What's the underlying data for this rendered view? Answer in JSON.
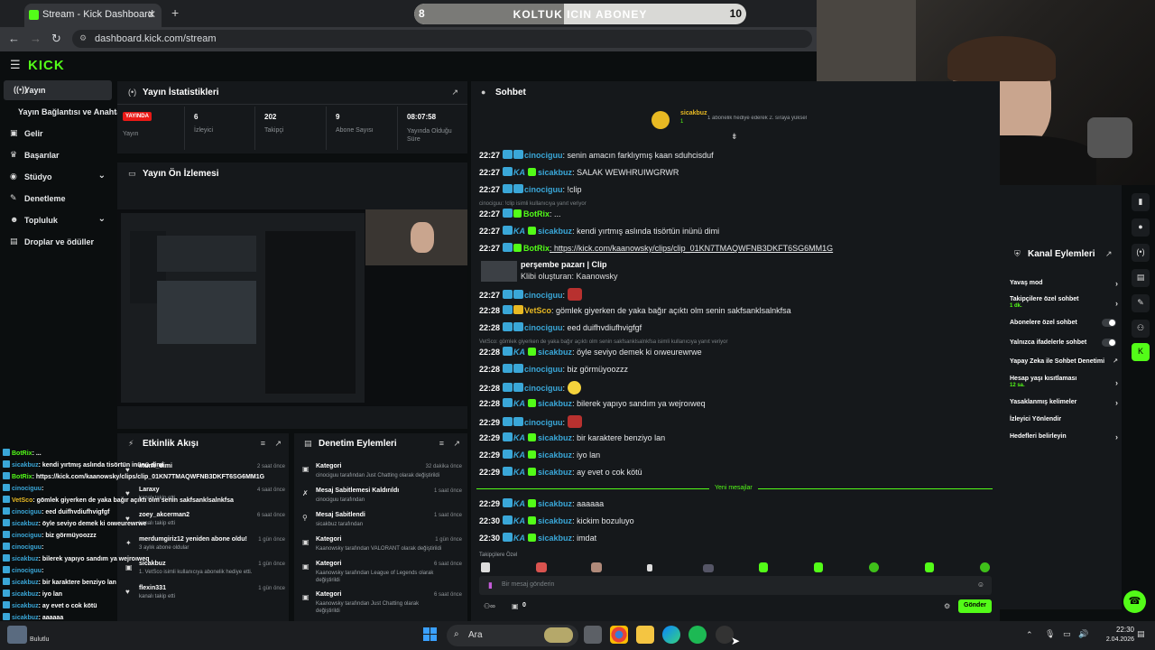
{
  "browser": {
    "tab_title": "Stream - Kick Dashboard",
    "url": "dashboard.kick.com/stream"
  },
  "overlay_goal": {
    "left": "8",
    "label": "KOLTUK ICIN ABONEY",
    "right": "10",
    "progress": 0.45
  },
  "kick": {
    "logo": "KICK"
  },
  "sidebar": {
    "items": [
      {
        "label": "Yayın"
      },
      {
        "label": "Yayın Bağlantısı ve Anahtarı"
      },
      {
        "label": "Gelir"
      },
      {
        "label": "Başarılar"
      },
      {
        "label": "Stüdyo"
      },
      {
        "label": "Denetleme"
      },
      {
        "label": "Topluluk"
      },
      {
        "label": "Droplar ve ödüller"
      }
    ]
  },
  "stats": {
    "title": "Yayın İstatistikleri",
    "live_badge": "YAYINDA",
    "items": [
      {
        "value": "",
        "label": "Yayın"
      },
      {
        "value": "6",
        "label": "İzleyici"
      },
      {
        "value": "202",
        "label": "Takipçi"
      },
      {
        "value": "9",
        "label": "Abone Sayısı"
      },
      {
        "value": "08:07:58",
        "label": "Yayında Olduğu Süre"
      }
    ]
  },
  "preview": {
    "title": "Yayın Ön İzlemesi"
  },
  "activity": {
    "title": "Etkinlik Akışı",
    "rows": [
      {
        "name": "inumi_dimi",
        "sub": "",
        "time": "2 saat önce"
      },
      {
        "name": "Laraxy",
        "sub": "kanalı takip etti",
        "time": "4 saat önce"
      },
      {
        "name": "zoey_akcerman2",
        "sub": "kanalı takip etti",
        "time": "6 saat önce"
      },
      {
        "name": "merdumgiriz12 yeniden abone oldu!",
        "sub": "3 aylık abone oldular",
        "time": "1 gün önce"
      },
      {
        "name": "sicakbuz",
        "sub": "1. VetSco isimli kullanıcıya abonelik hediye etti.",
        "time": "1 gün önce"
      },
      {
        "name": "flexin331",
        "sub": "kanalı takip etti",
        "time": "1 gün önce"
      }
    ]
  },
  "moderation": {
    "title": "Denetim Eylemleri",
    "rows": [
      {
        "name": "Kategori",
        "sub": "cinociguu tarafından Just Chatting olarak değiştirildi",
        "time": "32 dakika önce"
      },
      {
        "name": "Mesaj Sabitlemesi Kaldırıldı",
        "sub": "cinociguu tarafından",
        "time": "1 saat önce"
      },
      {
        "name": "Mesaj Sabitlendi",
        "sub": "sicakbuz tarafından",
        "time": "1 saat önce"
      },
      {
        "name": "Kategori",
        "sub": "Kaanowsky tarafından VALORANT olarak değiştirildi",
        "time": "1 gün önce"
      },
      {
        "name": "Kategori",
        "sub": "Kaanowsky tarafından League of Legends olarak değiştirildi",
        "time": "6 saat önce"
      },
      {
        "name": "Kategori",
        "sub": "Kaanowsky tarafından Just Chatting olarak değiştirildi",
        "time": "6 saat önce"
      }
    ]
  },
  "chat": {
    "title": "Sohbet",
    "gifter": "sicakbuz",
    "gifter_count": "1",
    "gifter_note": "1 abonelik hediye ederek 2. sıraya yüksel",
    "messages": [
      {
        "time": "22:27",
        "user": "cinociguu",
        "color": "#3aa7d8",
        "ka": false,
        "text": ": senin amacın farklıymış kaan sduhcisduf"
      },
      {
        "time": "22:27",
        "user": "sicakbuz",
        "color": "#3aa7d8",
        "ka": true,
        "text": ": SALAK WEWHRUIWGRWR"
      },
      {
        "time": "22:27",
        "user": "cinociguu",
        "color": "#3aa7d8",
        "ka": false,
        "text": ": !clip"
      },
      {
        "time": "22:27",
        "user": "BotRix",
        "color": "#53fc18",
        "ka": false,
        "text": ": ..."
      },
      {
        "time": "22:27",
        "user": "sicakbuz",
        "color": "#3aa7d8",
        "ka": true,
        "text": ": kendi yırtmış aslında tisörtün inünü dimi"
      },
      {
        "time": "22:27",
        "user": "BotRix",
        "color": "#53fc18",
        "ka": false,
        "text": ": https://kick.com/kaanowsky/clips/clip_01KN7TMAQWFNB3DKFT6SG6MM1G"
      },
      {
        "time": "22:27",
        "user": "cinociguu",
        "color": "#3aa7d8",
        "ka": false,
        "text": ":"
      },
      {
        "time": "22:28",
        "user": "VetSco",
        "color": "#e8b923",
        "ka": false,
        "text": ": gömlek giyerken de yaka bağır açıktı olm senin sakfsanklsalnkfsa"
      },
      {
        "time": "22:28",
        "user": "cinociguu",
        "color": "#3aa7d8",
        "ka": false,
        "text": ": eed duifhvdiufhvigfgf"
      },
      {
        "time": "22:28",
        "user": "sicakbuz",
        "color": "#3aa7d8",
        "ka": true,
        "text": ": öyle seviyo demek ki oıweurewrwe"
      },
      {
        "time": "22:28",
        "user": "cinociguu",
        "color": "#3aa7d8",
        "ka": false,
        "text": ": biz görmüyoozzz"
      },
      {
        "time": "22:28",
        "user": "cinociguu",
        "color": "#3aa7d8",
        "ka": false,
        "text": ":"
      },
      {
        "time": "22:28",
        "user": "sicakbuz",
        "color": "#3aa7d8",
        "ka": true,
        "text": ": bilerek yapıyo sandım ya wejroıweq"
      },
      {
        "time": "22:29",
        "user": "cinociguu",
        "color": "#3aa7d8",
        "ka": false,
        "text": ":"
      },
      {
        "time": "22:29",
        "user": "sicakbuz",
        "color": "#3aa7d8",
        "ka": true,
        "text": ": bir karaktere benziyo lan"
      },
      {
        "time": "22:29",
        "user": "sicakbuz",
        "color": "#3aa7d8",
        "ka": true,
        "text": ": iyo lan"
      },
      {
        "time": "22:29",
        "user": "sicakbuz",
        "color": "#3aa7d8",
        "ka": true,
        "text": ": ay evet o cok kötü"
      },
      {
        "time": "22:29",
        "user": "sicakbuz",
        "color": "#3aa7d8",
        "ka": true,
        "text": ": aaaaaa"
      },
      {
        "time": "22:30",
        "user": "sicakbuz",
        "color": "#3aa7d8",
        "ka": true,
        "text": ": kickim bozuluyo"
      },
      {
        "time": "22:30",
        "user": "sicakbuz",
        "color": "#3aa7d8",
        "ka": true,
        "text": ": imdat"
      }
    ],
    "system_clip": "cinociguu: !clip isimli kullanıcıya yanıt veriyor",
    "clip_title": "perşembe pazarı | Clip",
    "clip_author": "Klibi oluşturan: Kaanowsky",
    "system_vetsco": "VetSco: gömlek giyerken de yaka bağır açıktı olm senin sakfsanklsalnkfsa isimli kullanıcıya yanıt veriyor",
    "new_messages": "Yeni mesajlar",
    "followers_only": "Takipçilere Özel",
    "input_placeholder": "Bir mesaj gönderin",
    "send": "Gönder",
    "viewers_count": "0"
  },
  "channel_actions": {
    "title": "Kanal Eylemleri",
    "items": [
      {
        "label": "Yavaş mod",
        "sub": ""
      },
      {
        "label": "Takipçilere özel sohbet",
        "sub": "1 dk."
      },
      {
        "label": "Abonelere özel sohbet",
        "sub": ""
      },
      {
        "label": "Yalnızca ifadelerle sohbet",
        "sub": ""
      },
      {
        "label": "Yapay Zeka ile Sohbet Denetimi",
        "sub": ""
      },
      {
        "label": "Hesap yaşı kısıtlaması",
        "sub": "12 sa."
      },
      {
        "label": "Yasaklanmış kelimeler",
        "sub": ""
      },
      {
        "label": "İzleyici Yönlendir",
        "sub": ""
      },
      {
        "label": "Hedefleri belirleyin",
        "sub": ""
      }
    ]
  },
  "overlay_chat": [
    {
      "user": "BotRix",
      "text": ": ..."
    },
    {
      "user": "sicakbuz",
      "text": ": kendi yırtmış aslında tisörtün inünü dimi"
    },
    {
      "user": "BotRix",
      "text": ": https://kick.com/kaanowsky/clips/clip_01KN7TMAQWFNB3DKFT6SG6MM1G"
    },
    {
      "user": "cinociguu",
      "text": ":"
    },
    {
      "user": "VetSco",
      "text": ": gömlek giyerken de yaka bağır açıktı olm senin sakfsanklsalnkfsa"
    },
    {
      "user": "cinociguu",
      "text": ": eed duifhvdiufhvigfgf"
    },
    {
      "user": "sicakbuz",
      "text": ": öyle seviyo demek ki oıweurewrwe"
    },
    {
      "user": "cinociguu",
      "text": ": biz görmüyoozzz"
    },
    {
      "user": "cinociguu",
      "text": ":"
    },
    {
      "user": "sicakbuz",
      "text": ": bilerek yapıyo sandım ya wejroıweq"
    },
    {
      "user": "cinociguu",
      "text": ":"
    },
    {
      "user": "sicakbuz",
      "text": ": bir karaktere benziyo lan"
    },
    {
      "user": "sicakbuz",
      "text": ": iyo lan"
    },
    {
      "user": "sicakbuz",
      "text": ": ay evet o cok kötü"
    },
    {
      "user": "sicakbuz",
      "text": ": aaaaaa"
    },
    {
      "user": "sicakbuz",
      "text": ": kickim bozuluyo"
    },
    {
      "user": "sicakbuz",
      "text": ": imdat"
    }
  ],
  "taskbar": {
    "search": "Ara",
    "weather": "Bulutlu",
    "time": "22:30",
    "date": "2.04.2026"
  }
}
